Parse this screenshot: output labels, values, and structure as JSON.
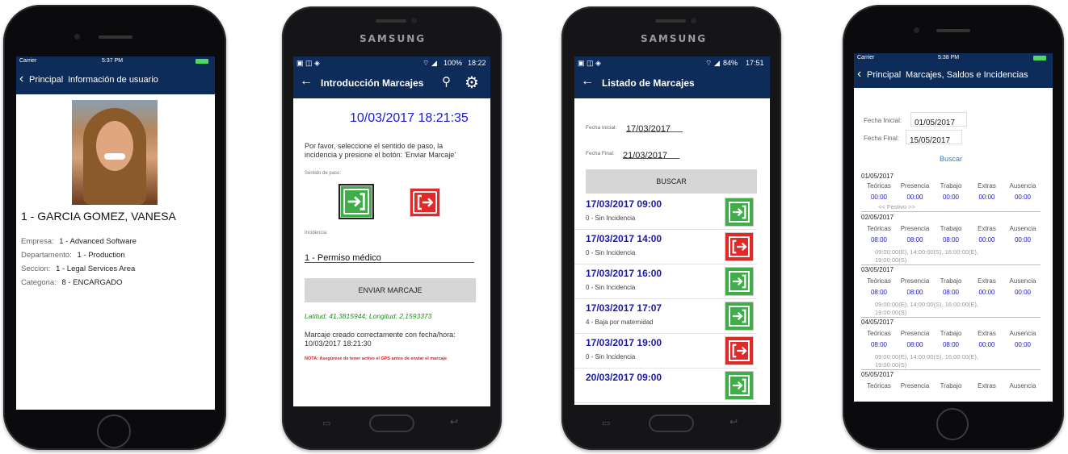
{
  "phone1": {
    "status": {
      "carrier": "Carrier",
      "time": "5:37 PM"
    },
    "nav": {
      "back_label": "Principal",
      "title": "Información de usuario"
    },
    "user_name": "1 - GARCIA GOMEZ, VANESA",
    "fields": [
      {
        "label": "Empresa:",
        "value": "1 - Advanced Software"
      },
      {
        "label": "Departamento:",
        "value": "1 - Production"
      },
      {
        "label": "Seccion:",
        "value": "1 - Legal Services Area"
      },
      {
        "label": "Categoria:",
        "value": "8 - ENCARGADO"
      }
    ]
  },
  "phone2": {
    "brand": "SAMSUNG",
    "status": {
      "battery": "100%",
      "time": "18:22"
    },
    "nav": {
      "title": "Introducción Marcajes"
    },
    "datetime": "10/03/2017 18:21:35",
    "instructions": [
      "Por favor, seleccione el sentido de paso, la",
      "incidencia y presione el botón: 'Enviar Marcaje'"
    ],
    "sentido_label": "Sentido de paso:",
    "incidencia_label": "Incidencia:",
    "incidencia_value": "1 - Permiso médico",
    "send_button": "ENVIAR MARCAJE",
    "coords": "Latitud: 41,3815944; Longitud: 2,1593373",
    "result": [
      "Marcaje creado correctamente con fecha/hora:",
      "10/03/2017 18:21:30"
    ],
    "note": "NOTA: Asegúrese de tener activo el GPS antes de enviar el marcaje"
  },
  "phone3": {
    "brand": "SAMSUNG",
    "status": {
      "battery": "84%",
      "time": "17:51"
    },
    "nav": {
      "title": "Listado de Marcajes"
    },
    "fecha_inicial_label": "Fecha Inicial:",
    "fecha_inicial": "17/03/2017",
    "fecha_final_label": "Fecha Final:",
    "fecha_final": "21/03/2017",
    "search_button": "BUSCAR",
    "rows": [
      {
        "date": "17/03/2017 09:00",
        "incidence": "0 - Sin Incidencia"
      },
      {
        "date": "17/03/2017 14:00",
        "incidence": "0 - Sin Incidencia"
      },
      {
        "date": "17/03/2017 16:00",
        "incidence": "0 - Sin Incidencia"
      },
      {
        "date": "17/03/2017 17:07",
        "incidence": "4 - Baja por maternidad"
      },
      {
        "date": "17/03/2017 19:00",
        "incidence": "0 - Sin Incidencia"
      },
      {
        "date": "20/03/2017 09:00",
        "incidence": ""
      }
    ]
  },
  "phone4": {
    "status": {
      "carrier": "Carrier",
      "time": "5:38 PM"
    },
    "nav": {
      "back_label": "Principal",
      "title": "Marcajes, Saldos e Incidencias"
    },
    "fecha_inicial_label": "Fecha Inicial:",
    "fecha_inicial": "01/05/2017",
    "fecha_final_label": "Fecha Final:",
    "fecha_final": "15/05/2017",
    "search_link": "Buscar",
    "columns": [
      "Teóricas",
      "Presencia",
      "Trabajo",
      "Extras",
      "Ausencia"
    ],
    "days": [
      {
        "date": "01/05/2017",
        "values": [
          "00:00",
          "00:00",
          "00:00",
          "00:00",
          "00:00"
        ],
        "note1": "<< Festivo >>",
        "note2": ""
      },
      {
        "date": "02/05/2017",
        "values": [
          "08:00",
          "08:00",
          "08:00",
          "00:00",
          "00:00"
        ],
        "note1": "09:00:00(E), 14:00:00(S), 16:00:00(E),",
        "note2": "19:00:00(S)"
      },
      {
        "date": "03/05/2017",
        "values": [
          "08:00",
          "08:00",
          "08:00",
          "00:00",
          "00:00"
        ],
        "note1": "09:00:00(E), 14:00:00(S), 16:00:00(E),",
        "note2": "19:00:00(S)"
      },
      {
        "date": "04/05/2017",
        "values": [
          "08:00",
          "08:00",
          "08:00",
          "00:00",
          "00:00"
        ],
        "note1": "09:00:00(E), 14:00:00(S), 16:00:00(E),",
        "note2": "19:00:00(S)"
      },
      {
        "date": "05/05/2017",
        "values": [],
        "note1": "",
        "note2": ""
      }
    ]
  }
}
